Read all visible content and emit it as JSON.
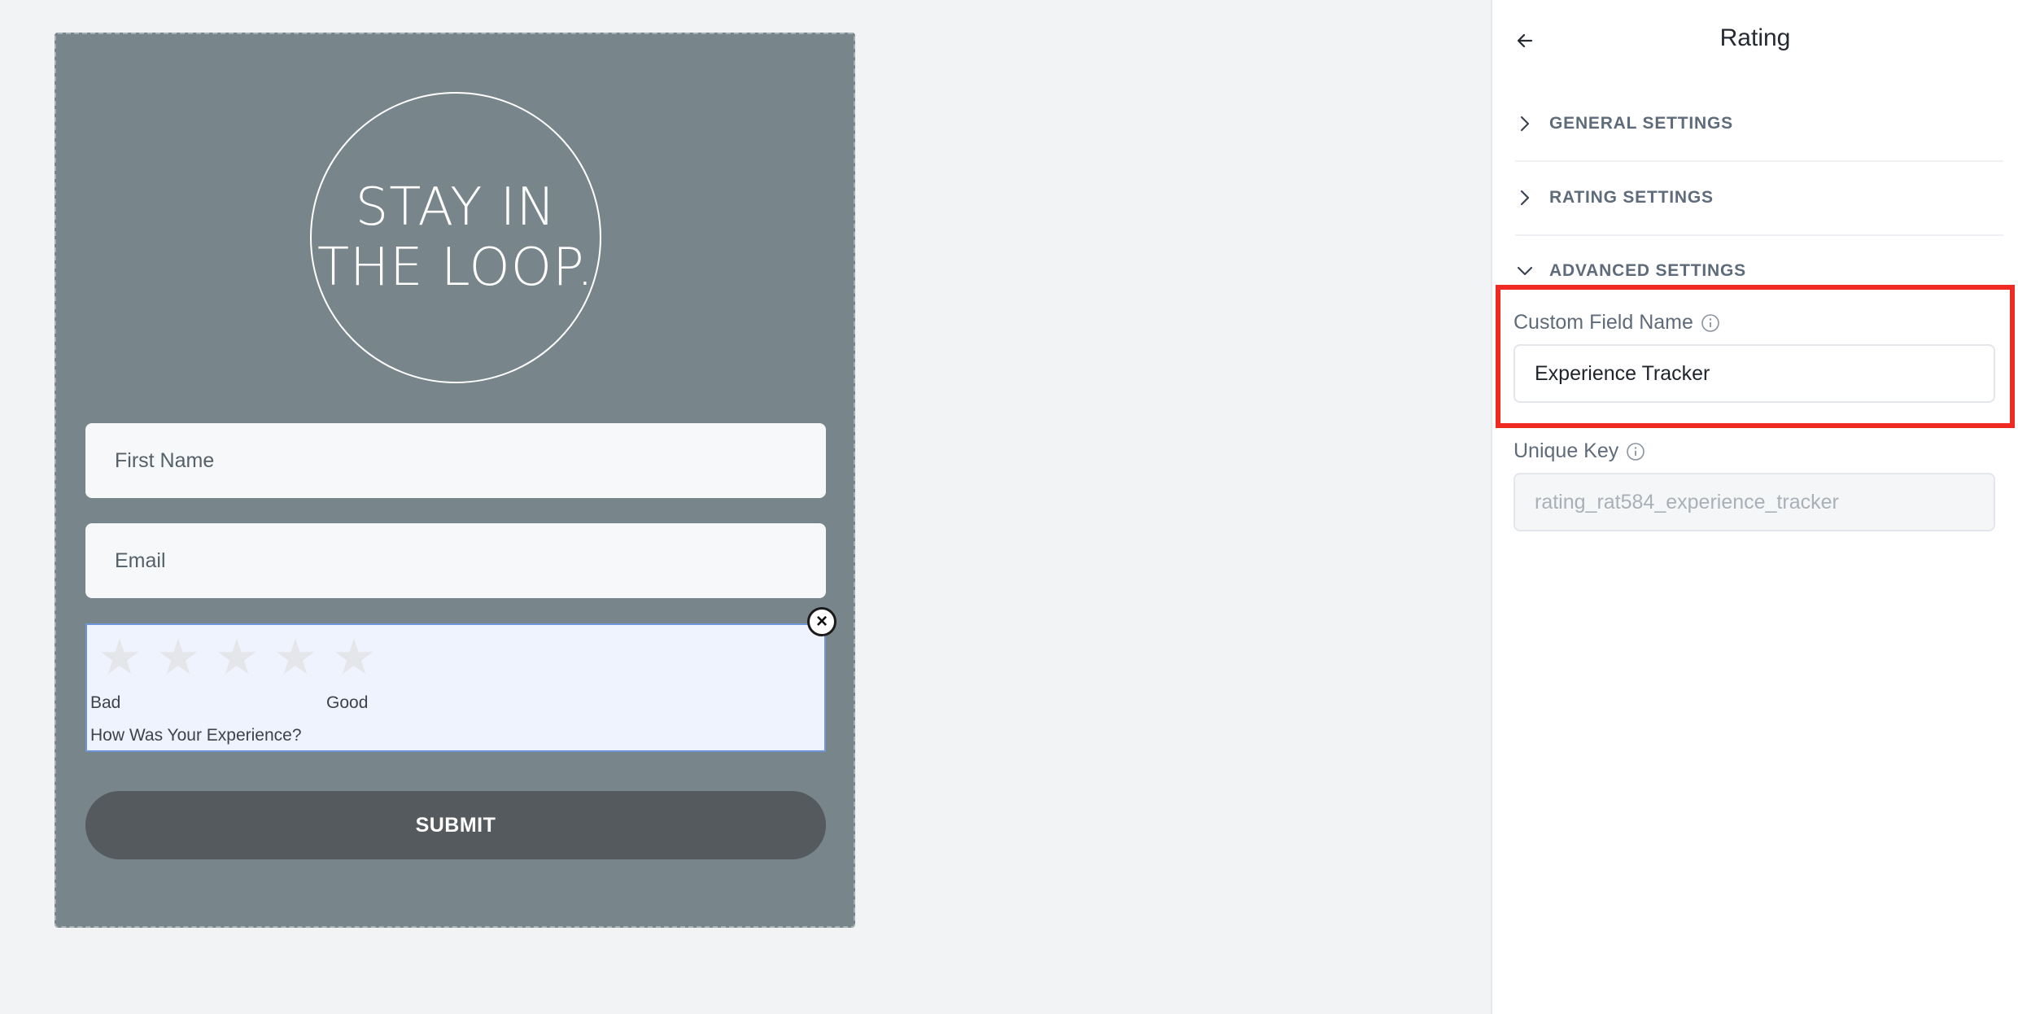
{
  "form_preview": {
    "logo_lines": [
      "STAY IN",
      "THE LOOP."
    ],
    "fields": [
      {
        "placeholder": "First Name"
      },
      {
        "placeholder": "Email"
      }
    ],
    "rating": {
      "star_count": 5,
      "selected_stars": 0,
      "low_label": "Bad",
      "high_label": "Good",
      "question": "How Was Your Experience?"
    },
    "submit_label": "SUBMIT",
    "colors": {
      "card_bg": "#78858b",
      "submit_bg": "#545a5d",
      "rating_selected_border": "#6d95d8"
    }
  },
  "panel": {
    "title": "Rating",
    "back_icon": "arrow-left-icon",
    "sections": [
      {
        "label": "GENERAL SETTINGS",
        "expanded": false,
        "icon": "chevron-right-icon"
      },
      {
        "label": "RATING SETTINGS",
        "expanded": false,
        "icon": "chevron-right-icon"
      },
      {
        "label": "ADVANCED SETTINGS",
        "expanded": true,
        "icon": "chevron-down-icon"
      }
    ],
    "custom_field_name": {
      "label": "Custom Field Name",
      "value": "Experience Tracker",
      "info_icon": "info-icon"
    },
    "unique_key": {
      "label": "Unique Key",
      "value": "rating_rat584_experience_tracker",
      "info_icon": "info-icon",
      "disabled": true
    },
    "highlight_color": "#ee2a22"
  }
}
